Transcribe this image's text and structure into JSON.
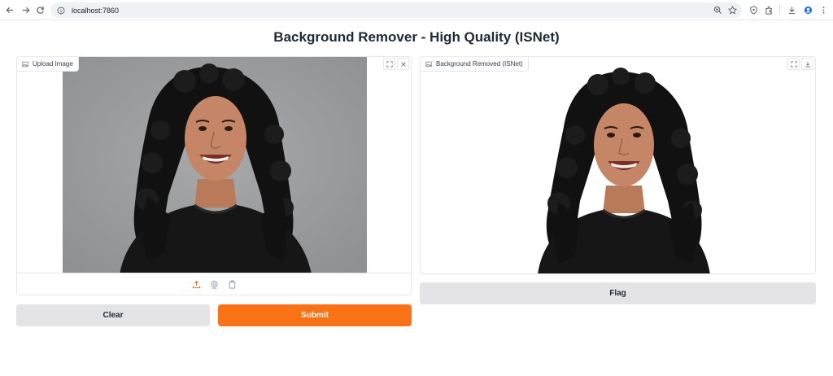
{
  "browser": {
    "url": "localhost:7860"
  },
  "page": {
    "title": "Background Remover - High Quality (ISNet)"
  },
  "input_panel": {
    "label": "Upload Image",
    "icon": "image-icon",
    "sources": [
      "upload-icon",
      "webcam-icon",
      "clipboard-icon"
    ]
  },
  "output_panel": {
    "label": "Background Removed (ISNet)",
    "icon": "image-icon"
  },
  "buttons": {
    "clear": "Clear",
    "submit": "Submit",
    "flag": "Flag"
  },
  "colors": {
    "primary": "#f97316",
    "secondary": "#e4e4e7",
    "photo_bg": "#9a9c9e"
  }
}
